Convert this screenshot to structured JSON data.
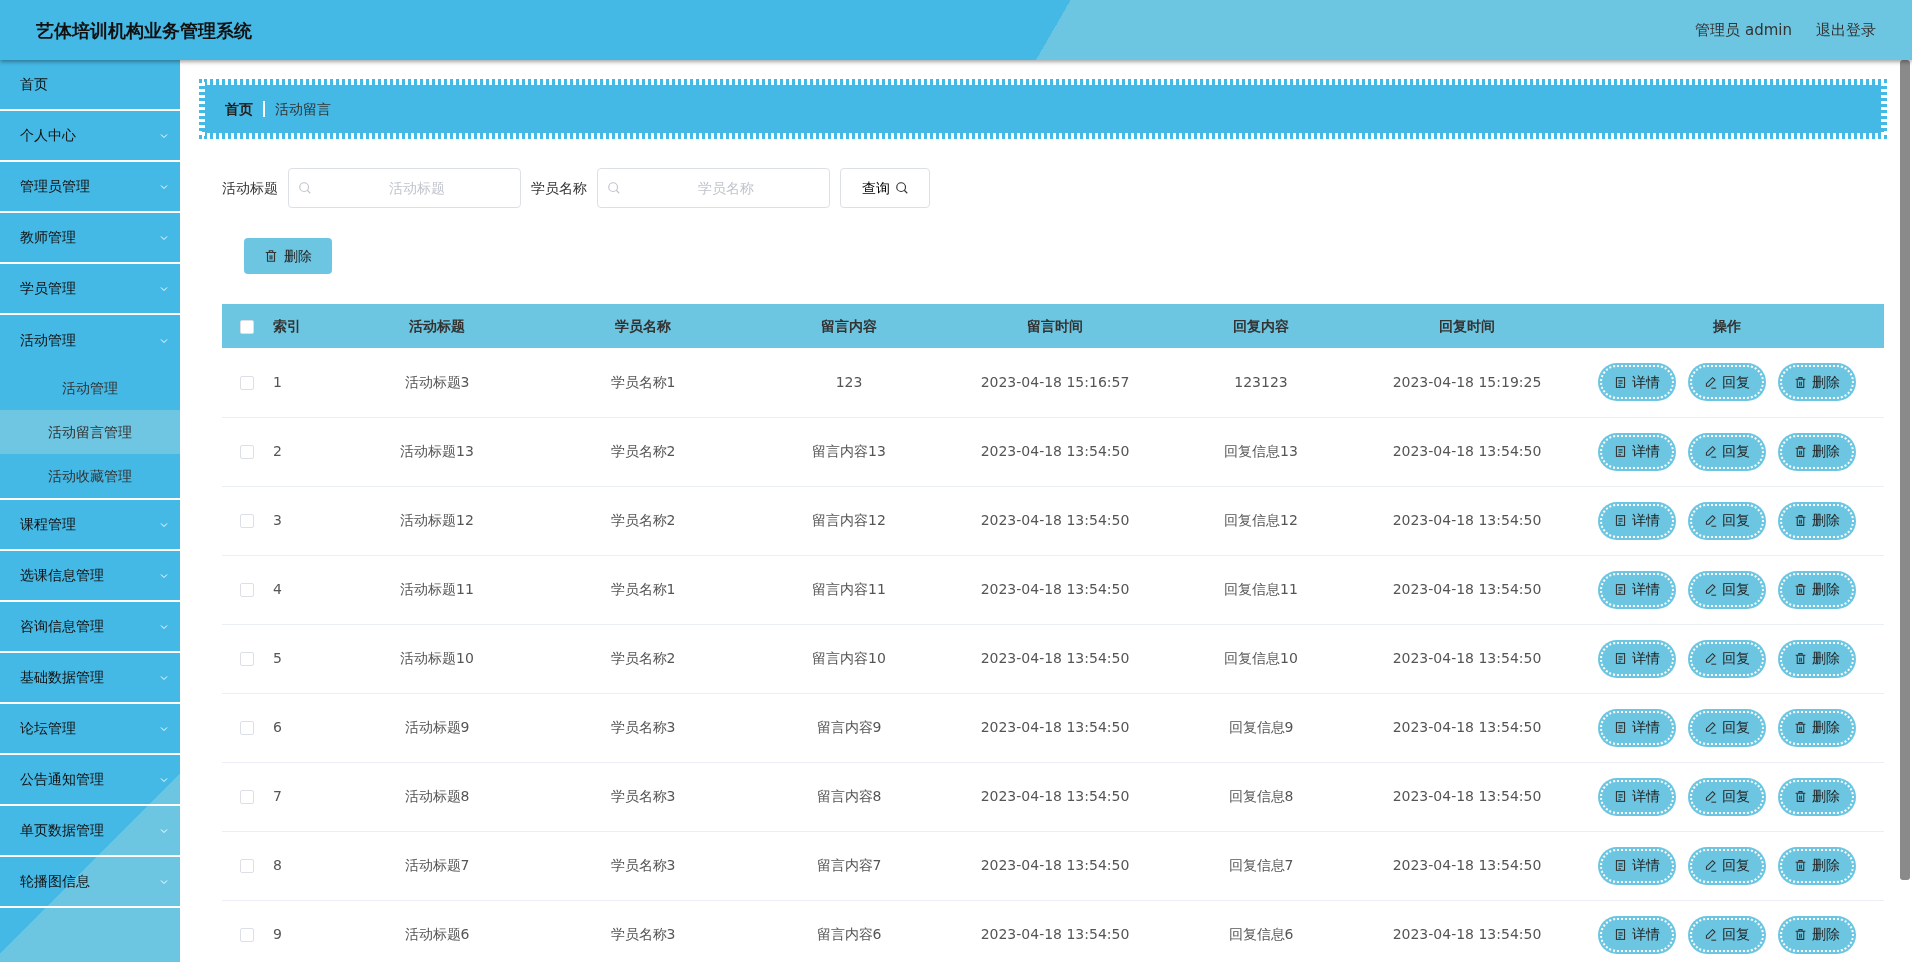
{
  "header": {
    "title": "艺体培训机构业务管理系统",
    "user": "管理员 admin",
    "logout": "退出登录"
  },
  "sidebar": {
    "items": [
      {
        "label": "首页",
        "kind": "link"
      },
      {
        "label": "个人中心",
        "kind": "menu"
      },
      {
        "label": "管理员管理",
        "kind": "menu"
      },
      {
        "label": "教师管理",
        "kind": "menu"
      },
      {
        "label": "学员管理",
        "kind": "menu"
      },
      {
        "label": "活动管理",
        "kind": "menu",
        "children": [
          {
            "label": "活动管理",
            "selected": false
          },
          {
            "label": "活动留言管理",
            "selected": true
          },
          {
            "label": "活动收藏管理",
            "selected": false
          }
        ]
      },
      {
        "label": "课程管理",
        "kind": "menu"
      },
      {
        "label": "选课信息管理",
        "kind": "menu"
      },
      {
        "label": "咨询信息管理",
        "kind": "menu"
      },
      {
        "label": "基础数据管理",
        "kind": "menu"
      },
      {
        "label": "论坛管理",
        "kind": "menu"
      },
      {
        "label": "公告通知管理",
        "kind": "menu"
      },
      {
        "label": "单页数据管理",
        "kind": "menu"
      },
      {
        "label": "轮播图信息",
        "kind": "menu"
      }
    ]
  },
  "breadcrumb": [
    "首页",
    "活动留言"
  ],
  "search": {
    "fields": [
      {
        "label": "活动标题",
        "placeholder": "活动标题"
      },
      {
        "label": "学员名称",
        "placeholder": "学员名称"
      }
    ],
    "button": "查询"
  },
  "toolbar": {
    "delete_button": "删除"
  },
  "table": {
    "select_all_checked": false,
    "columns": [
      "索引",
      "活动标题",
      "学员名称",
      "留言内容",
      "留言时间",
      "回复内容",
      "回复时间",
      "操作"
    ],
    "rows": [
      {
        "checked": false,
        "cells": [
          "1",
          "活动标题3",
          "学员名称1",
          "123",
          "2023-04-18 15:16:57",
          "123123",
          "2023-04-18 15:19:25"
        ],
        "actions": [
          "详情",
          "回复",
          "删除"
        ]
      },
      {
        "checked": false,
        "cells": [
          "2",
          "活动标题13",
          "学员名称2",
          "留言内容13",
          "2023-04-18 13:54:50",
          "回复信息13",
          "2023-04-18 13:54:50"
        ],
        "actions": [
          "详情",
          "回复",
          "删除"
        ]
      },
      {
        "checked": false,
        "cells": [
          "3",
          "活动标题12",
          "学员名称2",
          "留言内容12",
          "2023-04-18 13:54:50",
          "回复信息12",
          "2023-04-18 13:54:50"
        ],
        "actions": [
          "详情",
          "回复",
          "删除"
        ]
      },
      {
        "checked": false,
        "cells": [
          "4",
          "活动标题11",
          "学员名称1",
          "留言内容11",
          "2023-04-18 13:54:50",
          "回复信息11",
          "2023-04-18 13:54:50"
        ],
        "actions": [
          "详情",
          "回复",
          "删除"
        ]
      },
      {
        "checked": false,
        "cells": [
          "5",
          "活动标题10",
          "学员名称2",
          "留言内容10",
          "2023-04-18 13:54:50",
          "回复信息10",
          "2023-04-18 13:54:50"
        ],
        "actions": [
          "详情",
          "回复",
          "删除"
        ]
      },
      {
        "checked": false,
        "cells": [
          "6",
          "活动标题9",
          "学员名称3",
          "留言内容9",
          "2023-04-18 13:54:50",
          "回复信息9",
          "2023-04-18 13:54:50"
        ],
        "actions": [
          "详情",
          "回复",
          "删除"
        ]
      },
      {
        "checked": false,
        "cells": [
          "7",
          "活动标题8",
          "学员名称3",
          "留言内容8",
          "2023-04-18 13:54:50",
          "回复信息8",
          "2023-04-18 13:54:50"
        ],
        "actions": [
          "详情",
          "回复",
          "删除"
        ]
      },
      {
        "checked": false,
        "cells": [
          "8",
          "活动标题7",
          "学员名称3",
          "留言内容7",
          "2023-04-18 13:54:50",
          "回复信息7",
          "2023-04-18 13:54:50"
        ],
        "actions": [
          "详情",
          "回复",
          "删除"
        ]
      },
      {
        "checked": false,
        "cells": [
          "9",
          "活动标题6",
          "学员名称3",
          "留言内容6",
          "2023-04-18 13:54:50",
          "回复信息6",
          "2023-04-18 13:54:50"
        ],
        "actions": [
          "详情",
          "回复",
          "删除"
        ]
      }
    ]
  }
}
